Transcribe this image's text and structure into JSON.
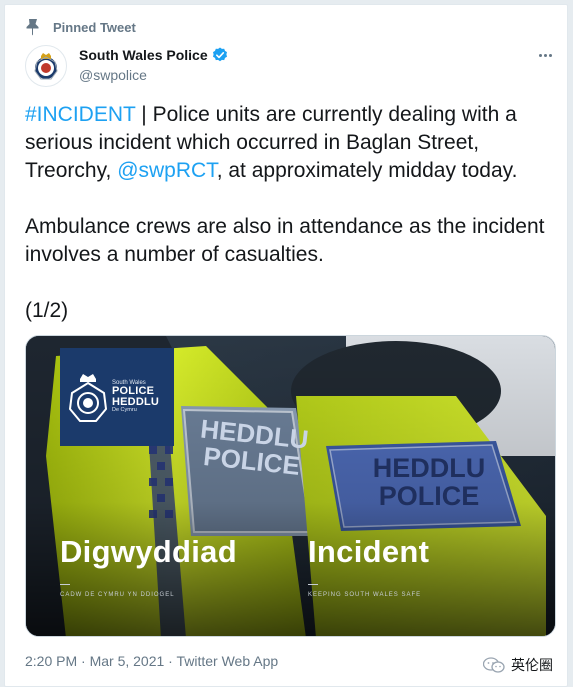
{
  "pinned": {
    "label": "Pinned Tweet"
  },
  "author": {
    "display_name": "South Wales Police",
    "handle": "@swpolice",
    "verified": true,
    "avatar_icon": "police-crest-icon"
  },
  "tweet": {
    "hashtag": "#INCIDENT",
    "line1_rest": " | Police units are currently dealing with a serious incident which occurred in Baglan Street, Treorchy, ",
    "mention": "@swpRCT",
    "line1_end": ", at approximately midday today.",
    "paragraph2": "Ambulance crews are also in attendance as the incident involves a number of casualties.",
    "paragraph3": "(1/2)"
  },
  "media": {
    "logo": {
      "small_text": "South Wales",
      "line1": "POLICE",
      "line2": "HEDDLU",
      "tiny_text": "De Cymru"
    },
    "vest_left_text": "HEDDLU\nPOLICE",
    "vest_right_text": "HEDDLU\nPOLICE",
    "word_left": "Digwyddiad",
    "word_right": "Incident",
    "tagline_left": "CADW DE CYMRU YN DDIOGEL",
    "tagline_right": "KEEPING SOUTH WALES SAFE"
  },
  "meta": {
    "timestamp": "2:20 PM · Mar 5, 2021 · Twitter Web App"
  },
  "watermark": {
    "text": "英伦圈"
  },
  "colors": {
    "link": "#1da1f2",
    "verified": "#1da1f2",
    "text": "#14171a",
    "secondary": "#657786",
    "hi_vis": "#cde41a",
    "logo_blue": "#1b3a6b"
  }
}
